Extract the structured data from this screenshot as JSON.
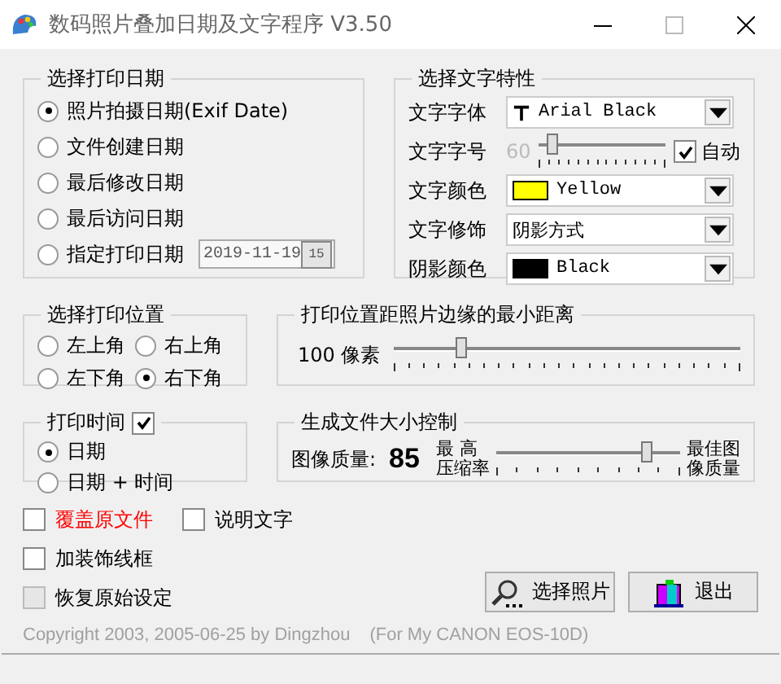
{
  "window": {
    "title": "数码照片叠加日期及文字程序  V3.50"
  },
  "date_group": {
    "title": "选择打印日期",
    "options": [
      {
        "label": "照片拍摄日期(Exif Date)",
        "selected": true
      },
      {
        "label": "文件创建日期",
        "selected": false
      },
      {
        "label": "最后修改日期",
        "selected": false
      },
      {
        "label": "最后访问日期",
        "selected": false
      },
      {
        "label": "指定打印日期",
        "selected": false
      }
    ],
    "date_field": {
      "value": "2019-11-19",
      "button": "15"
    }
  },
  "text_group": {
    "title": "选择文字特性",
    "font": {
      "label": "文字字体",
      "value": "Arial Black"
    },
    "size": {
      "label": "文字字号",
      "value": "60",
      "disabled": true,
      "level": 0.12,
      "auto_label": "自动",
      "auto_checked": true
    },
    "color": {
      "label": "文字颜色",
      "value": "Yellow",
      "color": "#ffff00"
    },
    "effect": {
      "label": "文字修饰",
      "value": "阴影方式"
    },
    "shadow": {
      "label": "阴影颜色",
      "value": "Black",
      "color": "#000000"
    }
  },
  "position_group": {
    "title": "选择打印位置",
    "options": [
      {
        "label": "左上角",
        "selected": false
      },
      {
        "label": "右上角",
        "selected": false
      },
      {
        "label": "左下角",
        "selected": false
      },
      {
        "label": "右下角",
        "selected": true
      }
    ]
  },
  "distance_group": {
    "title": "打印位置距照片边缘的最小距离",
    "value": "100",
    "unit": "像素",
    "level": 0.2
  },
  "time_group": {
    "title": "打印时间",
    "checked": true,
    "options": [
      {
        "label": "日期",
        "selected": true
      },
      {
        "label": "日期 + 时间",
        "selected": false
      }
    ]
  },
  "size_group": {
    "title": "生成文件大小控制",
    "quality_label": "图像质量:",
    "quality": "85",
    "min_label": [
      "最 高",
      "压缩率"
    ],
    "max_label": [
      "最佳图",
      "像质量"
    ],
    "level": 0.82
  },
  "checkboxes": [
    {
      "label": "覆盖原文件",
      "checked": false,
      "kind": "box",
      "color": "#ff0000"
    },
    {
      "label": "说明文字",
      "checked": false,
      "kind": "box",
      "color": "#000000"
    },
    {
      "label": "加装饰线框",
      "checked": false,
      "kind": "box",
      "color": "#000000"
    },
    {
      "label": "恢复原始设定",
      "checked": false,
      "kind": "flat",
      "color": "#000000"
    }
  ],
  "buttons": [
    {
      "label": "选择照片",
      "kind": "search"
    },
    {
      "label": "退出",
      "kind": "exit"
    }
  ],
  "footer": {
    "copyright": "Copyright 2003, 2005-06-25 by Dingzhou",
    "note": "(For My CANON EOS-10D)"
  }
}
